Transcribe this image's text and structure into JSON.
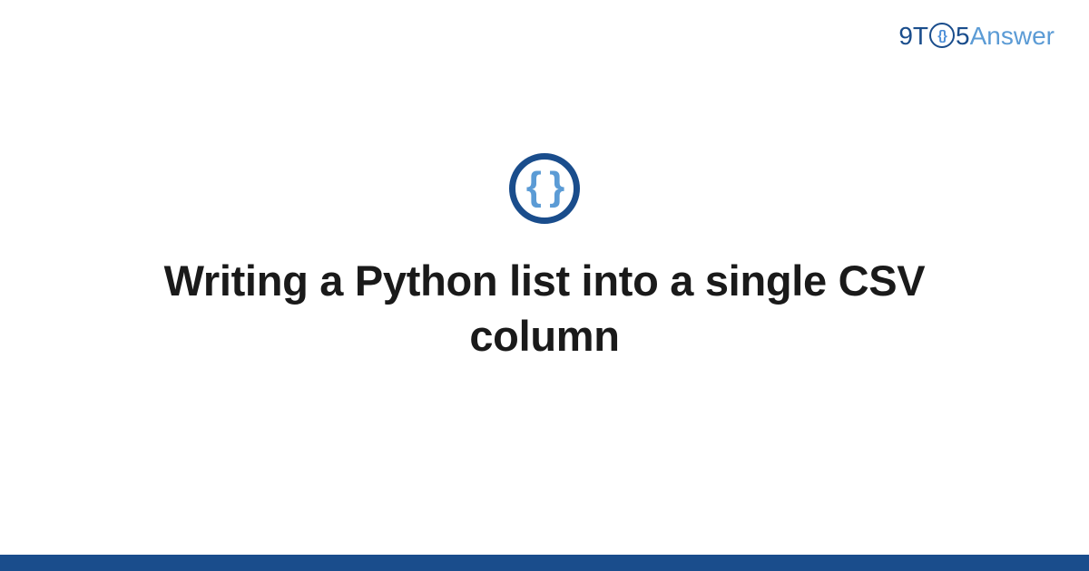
{
  "header": {
    "logo_9t": "9T",
    "logo_braces": "{}",
    "logo_5": "5",
    "logo_answer": "Answer"
  },
  "main": {
    "icon_braces": "{ }",
    "title": "Writing a Python list into a single CSV column"
  },
  "colors": {
    "primary_dark": "#1a4d8c",
    "primary_light": "#5b9bd5",
    "text": "#1a1a1a"
  }
}
